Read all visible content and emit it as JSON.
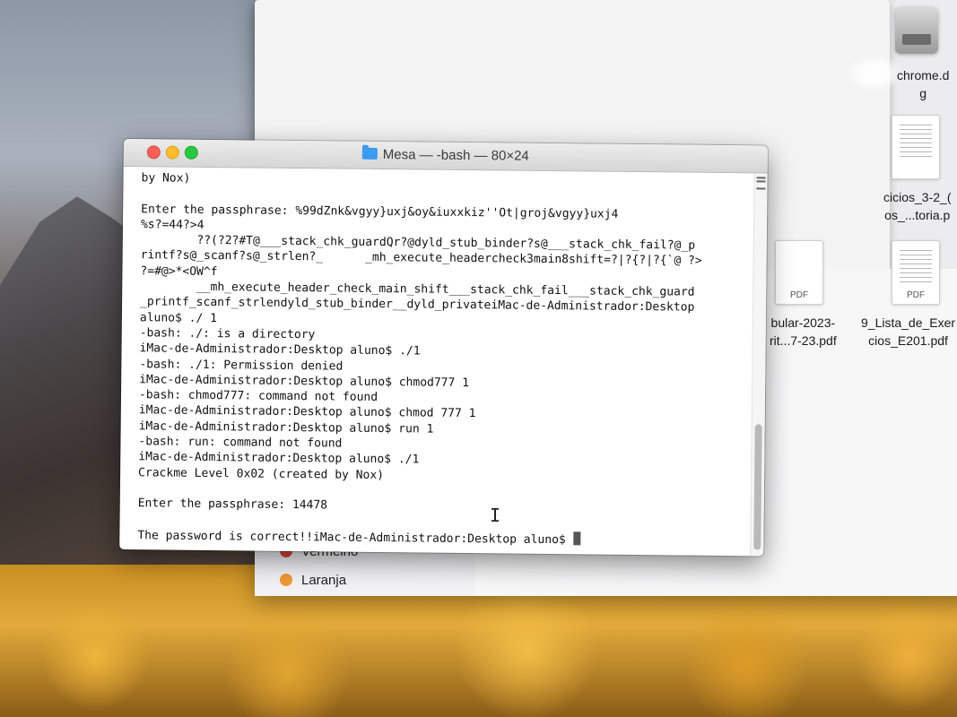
{
  "terminal": {
    "title": "Mesa — -bash — 80×24",
    "lines": [
      "by Nox)",
      "",
      "Enter the passphrase: %99dZnk&vgyy}uxj&oy&iuxxkiz''Ot|groj&vgyy}uxj4",
      "%s?=44?>4",
      "        ??(?2?#T@___stack_chk_guardQr?@dyld_stub_binder?s@___stack_chk_fail?@_p",
      "rintf?s@_scanf?s@_strlen?_      _mh_execute_headercheck3main8shift=?|?{?|?{`@ ?>",
      "?=#@>*<OW^f",
      "        __mh_execute_header_check_main_shift___stack_chk_fail___stack_chk_guard",
      "_printf_scanf_strlendyld_stub_binder__dyld_privateiMac-de-Administrador:Desktop",
      "aluno$ ./ 1",
      "-bash: ./: is a directory",
      "iMac-de-Administrador:Desktop aluno$ ./1",
      "-bash: ./1: Permission denied",
      "iMac-de-Administrador:Desktop aluno$ chmod777 1",
      "-bash: chmod777: command not found",
      "iMac-de-Administrador:Desktop aluno$ chmod 777 1",
      "iMac-de-Administrador:Desktop aluno$ run 1",
      "-bash: run: command not found",
      "iMac-de-Administrador:Desktop aluno$ ./1",
      "Crackme Level 0x02 (created by Nox)",
      "",
      "Enter the passphrase: 14478",
      "",
      "The password is correct!!iMac-de-Administrador:Desktop aluno$ "
    ]
  },
  "finder": {
    "tags": [
      {
        "label": "Vermelho",
        "color": "#e0443e"
      },
      {
        "label": "Laranja",
        "color": "#f09a37"
      }
    ],
    "files": [
      {
        "label_line1": "chrome.d",
        "label_line2": "g"
      },
      {
        "label_line1": "cicios_3-2_(",
        "label_line2": "os_...toria.p"
      },
      {
        "label_line1": "bular-2023-",
        "label_line2": "rit...7-23.pdf"
      },
      {
        "label_line1": "9_Lista_de_Exer",
        "label_line2": "cios_E201.pdf"
      }
    ],
    "pdf_badge": "PDF"
  }
}
